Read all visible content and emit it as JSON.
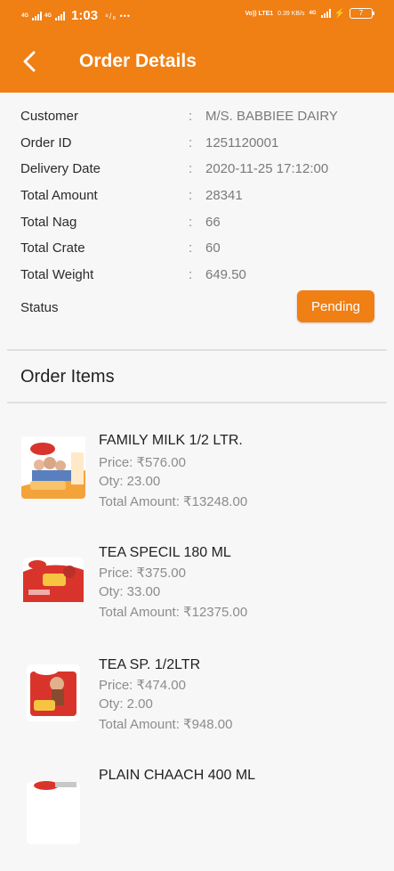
{
  "status_bar": {
    "net_left_1": "4G",
    "net_left_2": "4G",
    "time": "1:03",
    "extra": "⁸/₈ •••",
    "volte": "Vo)) LTE1",
    "speed": "0.39 KB/s",
    "net_right": "4G",
    "battery": "7"
  },
  "app_bar": {
    "title": "Order Details"
  },
  "details": [
    {
      "label": "Customer",
      "value": "M/S. BABBIEE DAIRY"
    },
    {
      "label": "Order ID",
      "value": "1251120001"
    },
    {
      "label": "Delivery Date",
      "value": "2020-11-25 17:12:00"
    },
    {
      "label": "Total Amount",
      "value": "28341"
    },
    {
      "label": "Total Nag",
      "value": "66"
    },
    {
      "label": "Total Crate",
      "value": "60"
    },
    {
      "label": "Total Weight",
      "value": "649.50"
    }
  ],
  "status": {
    "label": "Status",
    "value": "Pending"
  },
  "order_items_title": "Order Items",
  "items": [
    {
      "name": "FAMILY MILK 1/2 LTR.",
      "price": "Price: ₹576.00",
      "qty": "Oty: 23.00",
      "total": "Total Amount: ₹13248.00"
    },
    {
      "name": "TEA SPECIL 180 ML",
      "price": "Price: ₹375.00",
      "qty": "Oty: 33.00",
      "total": "Total Amount: ₹12375.00"
    },
    {
      "name": "TEA SP. 1/2LTR",
      "price": "Price: ₹474.00",
      "qty": "Oty: 2.00",
      "total": "Total Amount: ₹948.00"
    },
    {
      "name": "PLAIN CHAACH 400 ML",
      "price": "",
      "qty": "",
      "total": ""
    }
  ],
  "colors": {
    "accent": "#f07f14",
    "background": "#f7f7f7"
  }
}
